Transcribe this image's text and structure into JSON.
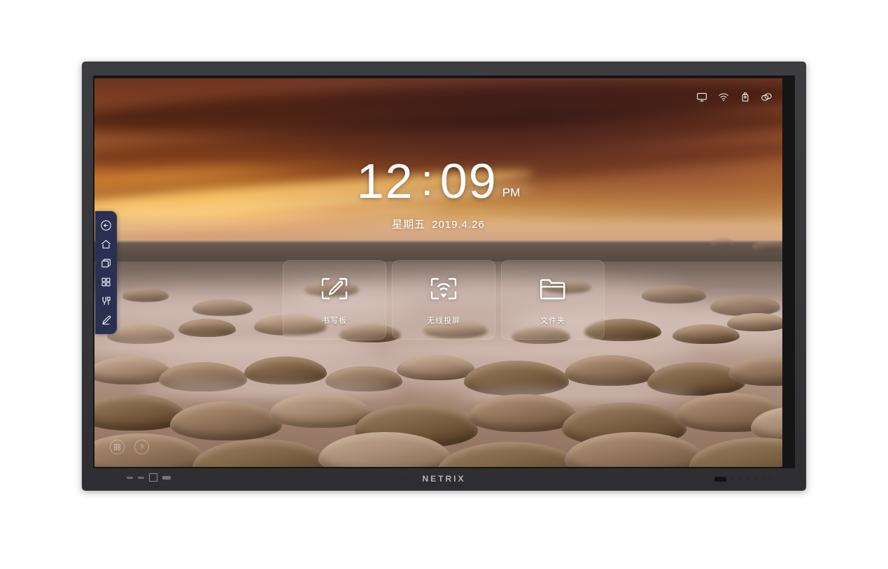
{
  "device": {
    "brand": "NETRIX",
    "type": "interactive-flat-panel-display"
  },
  "screen": {
    "statusbar": {
      "icons": [
        {
          "name": "display-monitor-icon",
          "label": "display"
        },
        {
          "name": "wifi-icon",
          "label": "wifi"
        },
        {
          "name": "usb-drive-icon",
          "label": "usb"
        },
        {
          "name": "link-loop-icon",
          "label": "link"
        }
      ]
    },
    "clock": {
      "hours": "12",
      "colon": ":",
      "minutes": "09",
      "ampm": "PM",
      "weekday": "星期五",
      "date": "2019.4.26"
    },
    "tiles": [
      {
        "label": "书写板",
        "icon": "whiteboard-pen-icon",
        "name": "tile-whiteboard"
      },
      {
        "label": "无线投屏",
        "icon": "wireless-cast-icon",
        "name": "tile-wireless-cast"
      },
      {
        "label": "文件夹",
        "icon": "folder-icon",
        "name": "tile-folder"
      }
    ],
    "sidedock": {
      "items": [
        {
          "name": "back-icon",
          "label": "back"
        },
        {
          "name": "home-icon",
          "label": "home"
        },
        {
          "name": "recent-windows-icon",
          "label": "recents"
        },
        {
          "name": "apps-grid-icon",
          "label": "apps"
        },
        {
          "name": "toolbox-icon",
          "label": "tools"
        },
        {
          "name": "pen-annotate-icon",
          "label": "annotate"
        }
      ]
    },
    "corner_buttons": [
      {
        "name": "apps-circle-icon",
        "label": "apps"
      },
      {
        "name": "help-circle-icon",
        "label": "help"
      }
    ]
  },
  "colors": {
    "dock_background": "#2a3052",
    "bezel": "#37373a",
    "accent_text": "#ffffff"
  }
}
